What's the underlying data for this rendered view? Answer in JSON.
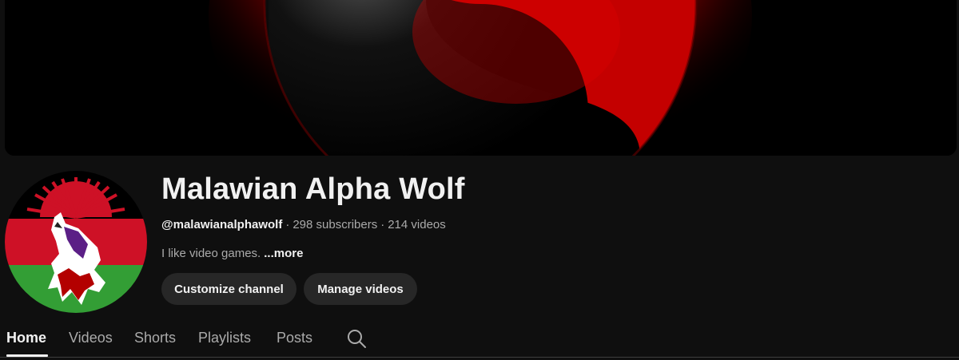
{
  "channel": {
    "name": "Malawian Alpha Wolf",
    "handle": "@malawianalphawolf",
    "separator": "·",
    "subscribers": "298 subscribers",
    "videos": "214 videos",
    "description": "I like video games.",
    "more_label": "...more"
  },
  "buttons": {
    "customize": "Customize channel",
    "manage": "Manage videos"
  },
  "tabs": [
    {
      "label": "Home",
      "active": true
    },
    {
      "label": "Videos",
      "active": false
    },
    {
      "label": "Shorts",
      "active": false
    },
    {
      "label": "Playlists",
      "active": false
    },
    {
      "label": "Posts",
      "active": false
    }
  ],
  "icons": {
    "tab_search": "search-icon"
  },
  "colors": {
    "background": "#0f0f0f",
    "button_bg": "#272727",
    "text_primary": "#f1f1f1",
    "text_secondary": "#aaaaaa",
    "banner_red": "#c00000",
    "flag_black": "#000000",
    "flag_red": "#ce1126",
    "flag_green": "#339e35"
  }
}
